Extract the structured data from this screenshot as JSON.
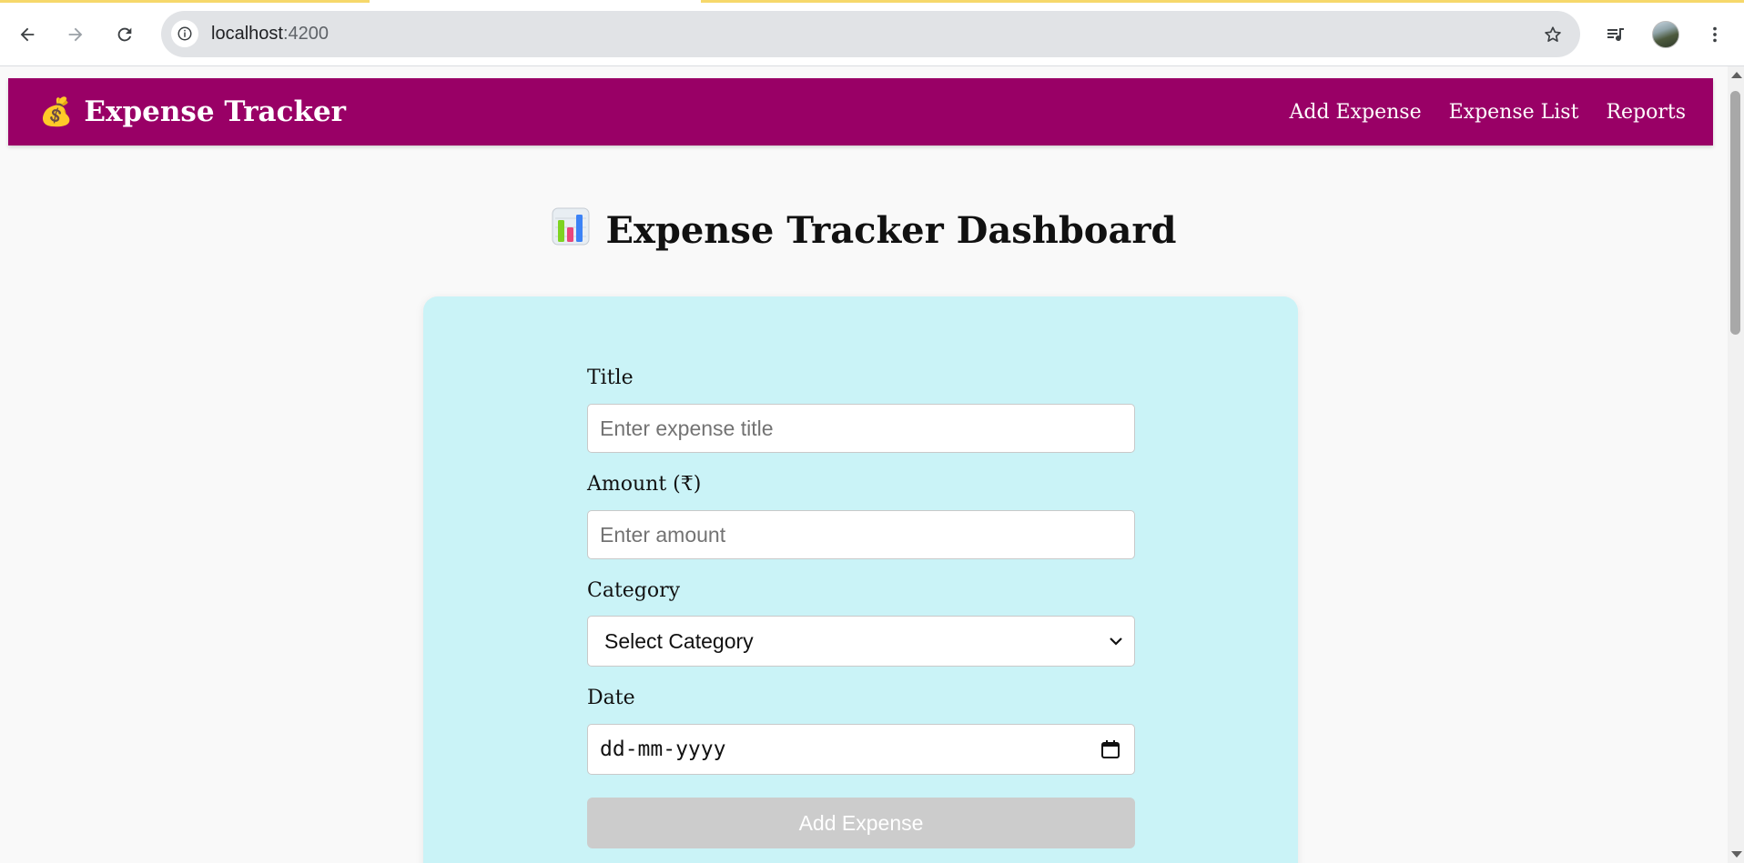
{
  "browser": {
    "url_host": "localhost",
    "url_port": ":4200",
    "icons": {
      "back": "arrow-left-icon",
      "forward": "arrow-right-icon",
      "reload": "reload-icon",
      "site_info": "info-icon",
      "bookmark": "star-icon",
      "media": "media-control-icon",
      "menu": "three-dot-menu-icon"
    }
  },
  "navbar": {
    "brand_icon": "💰",
    "brand": "Expense Tracker",
    "links": [
      "Add Expense",
      "Expense List",
      "Reports"
    ],
    "color": "#990066"
  },
  "page": {
    "heading": "Expense Tracker Dashboard",
    "heading_icon": "bar-chart-icon"
  },
  "form": {
    "background": "#caf3f7",
    "title_label": "Title",
    "title_placeholder": "Enter expense title",
    "amount_label": "Amount (₹)",
    "amount_placeholder": "Enter amount",
    "category_label": "Category",
    "category_selected": "Select Category",
    "date_label": "Date",
    "date_placeholder": "dd-mm-yyyy",
    "submit_label": "Add Expense",
    "submit_state": "disabled"
  }
}
